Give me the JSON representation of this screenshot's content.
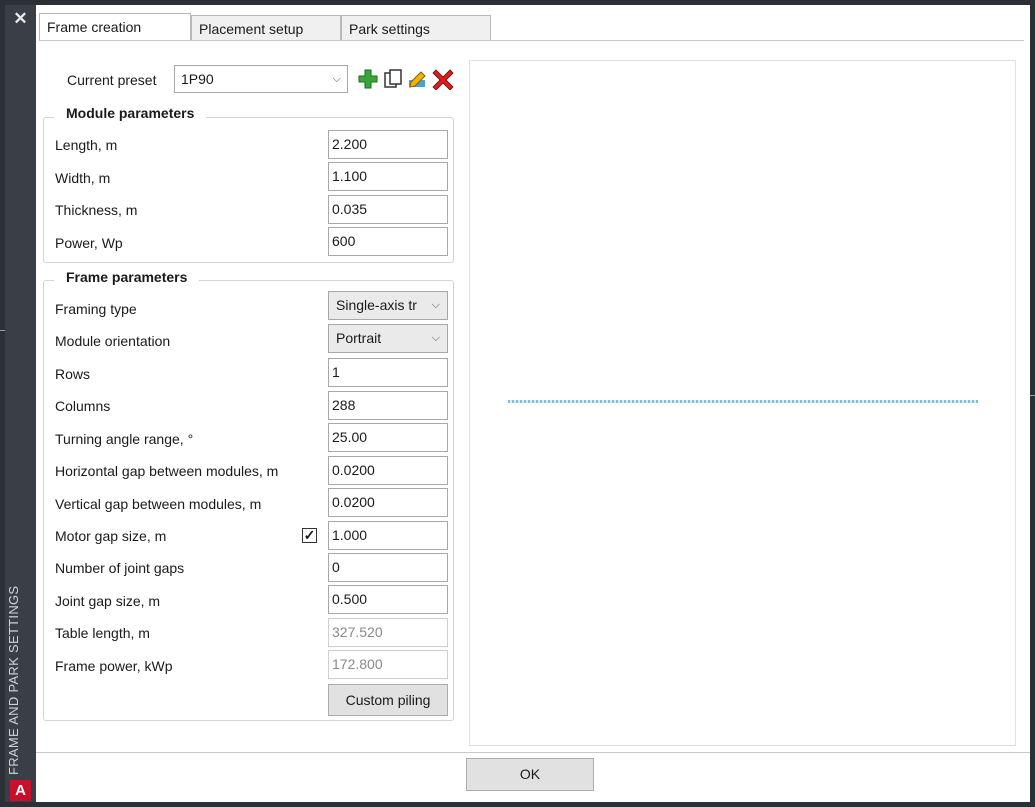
{
  "sidebar": {
    "title": "FRAME AND PARK SETTINGS",
    "close_glyph": "✕",
    "logo_letter": "A"
  },
  "tabs": [
    {
      "label": "Frame creation",
      "active": true
    },
    {
      "label": "Placement setup",
      "active": false
    },
    {
      "label": "Park settings",
      "active": false
    }
  ],
  "preset": {
    "label": "Current preset",
    "value": "1P90",
    "icons": [
      "add-icon",
      "copy-icon",
      "edit-icon",
      "delete-icon"
    ]
  },
  "module": {
    "title": "Module parameters",
    "rows": [
      {
        "label": "Length, m",
        "value": "2.200"
      },
      {
        "label": "Width, m",
        "value": "1.100"
      },
      {
        "label": "Thickness, m",
        "value": "0.035"
      },
      {
        "label": "Power, Wp",
        "value": "600"
      }
    ]
  },
  "frame": {
    "title": "Frame parameters",
    "framing_type": {
      "label": "Framing type",
      "value": "Single-axis tr"
    },
    "orientation": {
      "label": "Module orientation",
      "value": "Portrait"
    },
    "rows": {
      "label": "Rows",
      "value": "1"
    },
    "columns": {
      "label": "Columns",
      "value": "288"
    },
    "turning": {
      "label": "Turning angle range, °",
      "value": "25.00"
    },
    "hgap": {
      "label": "Horizontal gap between modules, m",
      "value": "0.0200"
    },
    "vgap": {
      "label": "Vertical gap between modules, m",
      "value": "0.0200"
    },
    "motor": {
      "label": "Motor gap size, m",
      "value": "1.000",
      "checked": true,
      "check_glyph": "✓"
    },
    "joint_count": {
      "label": "Number of joint gaps",
      "value": "0"
    },
    "joint_size": {
      "label": "Joint gap size, m",
      "value": "0.500"
    },
    "table_length": {
      "label": "Table length, m",
      "value": "327.520"
    },
    "frame_power": {
      "label": "Frame power, kWp",
      "value": "172.800"
    },
    "custom_piling_label": "Custom piling"
  },
  "footer": {
    "ok_label": "OK"
  },
  "colors": {
    "accent_red": "#c8102e",
    "add_green": "#3aa63a",
    "preview_line": "#7cc0d8"
  }
}
